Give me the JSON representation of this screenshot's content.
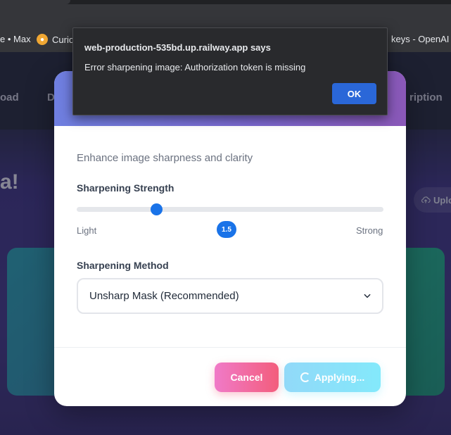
{
  "browser": {
    "bookmarks": [
      {
        "label": "e • Max"
      },
      {
        "label": "Curio"
      },
      {
        "label": "keys - OpenAI A"
      }
    ]
  },
  "background_page": {
    "nav_items": [
      "oad",
      "D",
      "ription"
    ],
    "heading": "a!",
    "upload_label": "Uplo"
  },
  "modal": {
    "subtitle": "Enhance image sharpness and clarity",
    "strength": {
      "label": "Sharpening Strength",
      "min_label": "Light",
      "max_label": "Strong",
      "value": "1.5",
      "fill_fraction": 0.26
    },
    "method": {
      "label": "Sharpening Method",
      "selected": "Unsharp Mask (Recommended)"
    },
    "buttons": {
      "cancel": "Cancel",
      "apply": "Applying..."
    }
  },
  "alert": {
    "title": "web-production-535bd.up.railway.app says",
    "message": "Error sharpening image: Authorization token is missing",
    "ok_label": "OK"
  },
  "colors": {
    "accent": "#1a73e8",
    "alert_ok": "#2a67d8",
    "header_gradient_start": "#6f7fe0",
    "header_gradient_end": "#8a58b8",
    "cancel_gradient": "#f35d7c",
    "apply_gradient": "#6ee5fb"
  }
}
